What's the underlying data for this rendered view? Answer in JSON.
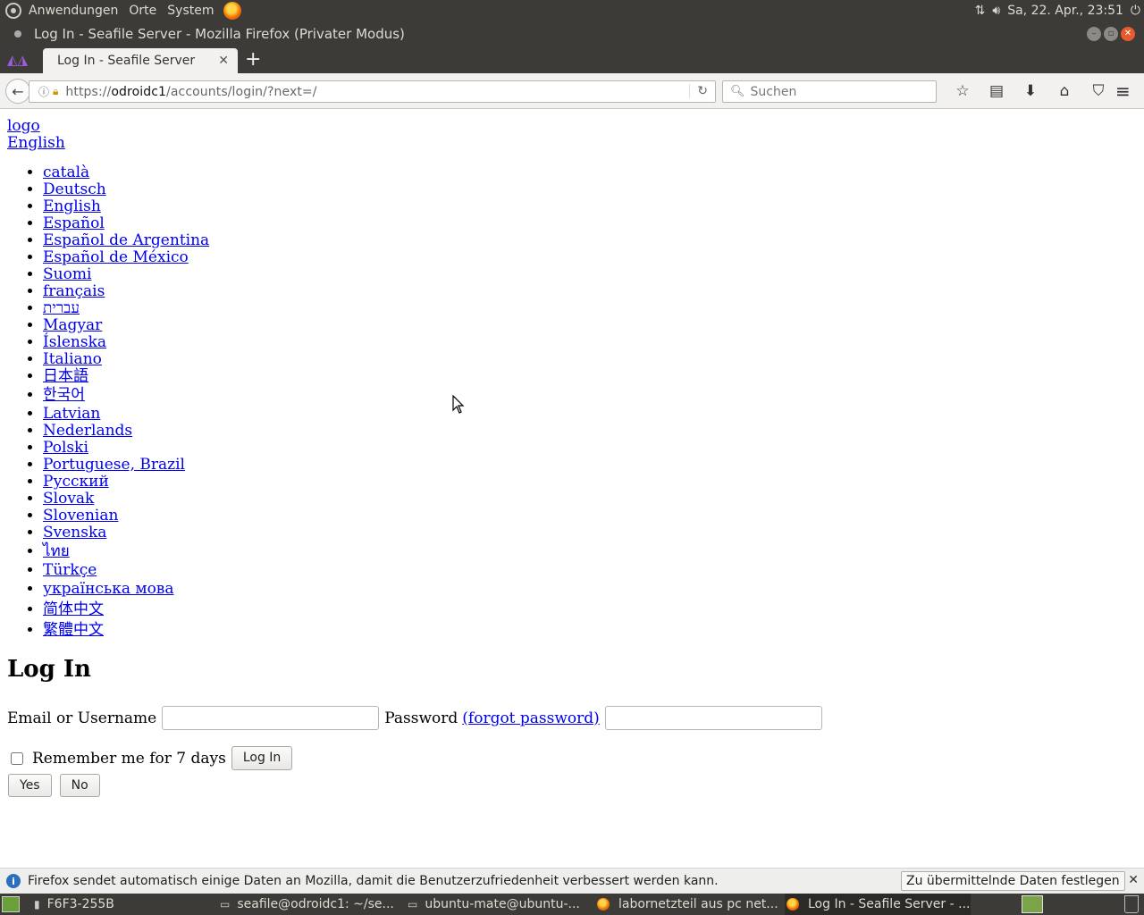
{
  "system_panel": {
    "menus": [
      "Anwendungen",
      "Orte",
      "System"
    ],
    "clock": "Sa, 22. Apr., 23:51"
  },
  "window": {
    "title": "Log In - Seafile Server - Mozilla Firefox (Privater Modus)"
  },
  "tabs": [
    {
      "label": "Log In - Seafile Server"
    }
  ],
  "navbar": {
    "url_prefix": "https://",
    "url_host": "odroidc1",
    "url_path": "/accounts/login/?next=/",
    "search_placeholder": "Suchen"
  },
  "page": {
    "logo_link": "logo",
    "current_language": "English",
    "languages": [
      "català",
      "Deutsch",
      "English",
      "Español",
      "Español de Argentina",
      "Español de México",
      "Suomi",
      "français",
      "עברית",
      "Magyar",
      "Íslenska",
      "Italiano",
      "日本語",
      "한국어",
      "Latvian",
      "Nederlands",
      "Polski",
      "Portuguese, Brazil",
      "Русский",
      "Slovak",
      "Slovenian",
      "Svenska",
      "ไทย",
      "Türkçe",
      "українська мова",
      "简体中文",
      "繁體中文"
    ],
    "heading": "Log In",
    "username_label": "Email or Username",
    "password_label": "Password",
    "forgot_password": "(forgot password)",
    "remember_label": "Remember me for 7 days",
    "login_button": "Log In",
    "yes_button": "Yes",
    "no_button": "No"
  },
  "notification": {
    "message": "Firefox sendet automatisch einige Daten an Mozilla, damit die Benutzerzufriedenheit verbessert werden kann.",
    "button": "Zu übermittelnde Daten festlegen"
  },
  "taskbar": {
    "items": [
      "F6F3-255B",
      "seafile@odroidc1: ~/se...",
      "ubuntu-mate@ubuntu-...",
      "labornetzteil aus pc net...",
      "Log In - Seafile Server - ..."
    ]
  },
  "colors": {
    "panel": "#3c3b37",
    "link": "#0000ee",
    "close_button": "#e65a2e"
  }
}
